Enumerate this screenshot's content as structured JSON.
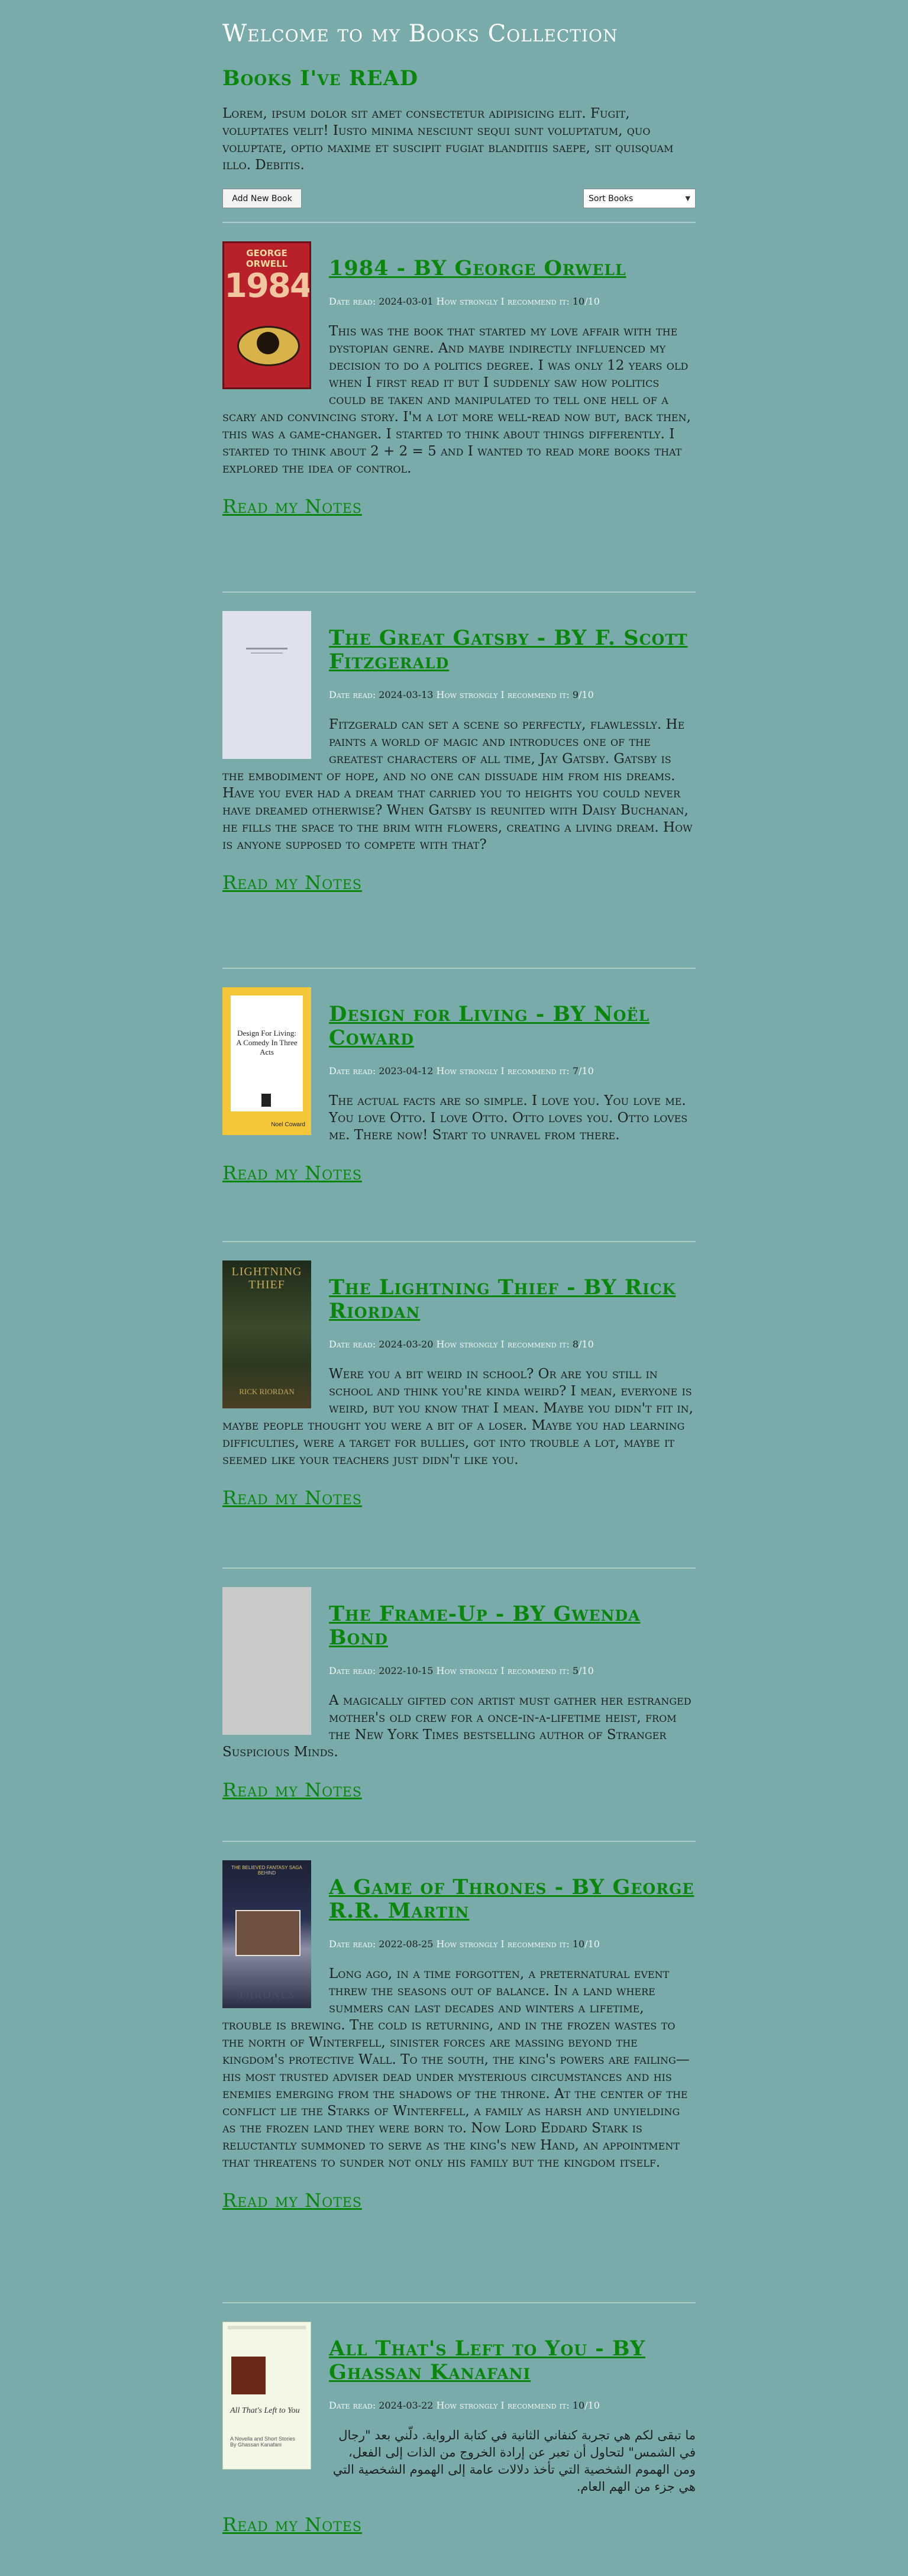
{
  "header": {
    "site_title": "Welcome to my Books Collection",
    "section_title": "Books I've READ",
    "intro": "Lorem, ipsum dolor sit amet consectetur adipisicing elit. Fugit, voluptates velit! Iusto minima nesciunt sequi sunt voluptatum, quo voluptate, optio maxime et suscipit fugiat blanditiis saepe, sit quisquam illo. Debitis."
  },
  "controls": {
    "add_label": "Add New Book",
    "sort_value": "Sort Books",
    "sort_icon": "chevron-down-icon"
  },
  "labels": {
    "date_read": "Date read:",
    "recommend": "How strongly I recommend it:",
    "notes_link": "Read my Notes"
  },
  "books": [
    {
      "title": "1984 - BY George Orwell",
      "date": "2024-03-01",
      "rating": "10",
      "out_of": "/10",
      "description": "This was the book that started my love affair with the dystopian genre. And maybe indirectly influenced my decision to do a politics degree. I was only 12 years old when I first read it but I suddenly saw how politics could be taken and manipulated to tell one hell of a scary and convincing story. I'm a lot more well-read now but, back then, this was a game-changer. I started to think about things differently. I started to think about 2 + 2 = 5 and I wanted to read more books that explored the idea of control.",
      "cover_text": [
        "GEORGE ORWELL",
        "1984"
      ]
    },
    {
      "title": "The Great Gatsby - BY F. Scott Fitzgerald",
      "date": "2024-03-13",
      "rating": "9",
      "out_of": "/10",
      "description": "Fitzgerald can set a scene so perfectly, flawlessly. He paints a world of magic and introduces one of the greatest characters of all time, Jay Gatsby. Gatsby is the embodiment of hope, and no one can dissuade him from his dreams. Have you ever had a dream that carried you to heights you could never have dreamed otherwise? When Gatsby is reunited with Daisy Buchanan, he fills the space to the brim with flowers, creating a living dream. How is anyone supposed to compete with that?"
    },
    {
      "title": "Design for Living - BY Noël Coward",
      "date": "2023-04-12",
      "rating": "7",
      "out_of": "/10",
      "description": "The actual facts are so simple. I love you. You love me. You love Otto. I love Otto. Otto loves you. Otto loves me. There now! Start to unravel from there.",
      "cover_text": [
        "Design For Living:",
        "A Comedy In Three Acts",
        "Noel Coward"
      ]
    },
    {
      "title": "The Lightning Thief - BY Rick Riordan",
      "date": "2024-03-20",
      "rating": "8",
      "out_of": "/10",
      "description": "Were you a bit weird in school? Or are you still in school and think you're kinda weird? I mean, everyone is weird, but you know that I mean. Maybe you didn't fit in, maybe people thought you were a bit of a loser. Maybe you had learning difficulties, were a target for bullies, got into trouble a lot, maybe it seemed like your teachers just didn't like you.",
      "cover_text": [
        "LIGHTNING",
        "THIEF",
        "RICK RIORDAN"
      ]
    },
    {
      "title": "The Frame-Up - BY Gwenda Bond",
      "date": "2022-10-15",
      "rating": "5",
      "out_of": "/10",
      "description": "A magically gifted con artist must gather her estranged mother's old crew for a once-in-a-lifetime heist, from the New York Times bestselling author of Stranger Suspicious Minds."
    },
    {
      "title": "A Game of Thrones - BY George R.R. Martin",
      "date": "2022-08-25",
      "rating": "10",
      "out_of": "/10",
      "description": "Long ago, in a time forgotten, a preternatural event threw the seasons out of balance. In a land where summers can last decades and winters a lifetime, trouble is brewing. The cold is returning, and in the frozen wastes to the north of Winterfell, sinister forces are massing beyond the kingdom's protective Wall. To the south, the king's powers are failing—his most trusted adviser dead under mysterious circumstances and his enemies emerging from the shadows of the throne. At the center of the conflict lie the Starks of Winterfell, a family as harsh and unyielding as the frozen land they were born to. Now Lord Eddard Stark is reluctantly summoned to serve as the king's new Hand, an appointment that threatens to sunder not only his family but the kingdom itself.",
      "cover_text": [
        "THE BELIEVED FANTASY SAGA BEHIND",
        "THRONES"
      ]
    },
    {
      "title": "All That's Left to You - BY Ghassan Kanafani",
      "date": "2024-03-22",
      "rating": "10",
      "out_of": "/10",
      "description": "ما تبقى لكم هي تجربة كنفاني الثانية في كتابة الرواية. دلّني بعد \"رجال في الشمس\" لتحاول أن تعبر عن إرادة الخروج من الذات إلى الفعل، ومن الهموم الشخصية التي تأخذ دلالات عامة إلى الهموم الشخصية التي هي جزء من الهم العام.",
      "cover_text": [
        "All That's Left to You",
        "A Novella and Short Stories",
        "By Ghassan Kanafani"
      ]
    }
  ],
  "colors": {
    "background": "#79abab",
    "accent_green": "#0a860a",
    "divider": "#aecccc",
    "meta_label": "#f3f7f7"
  }
}
